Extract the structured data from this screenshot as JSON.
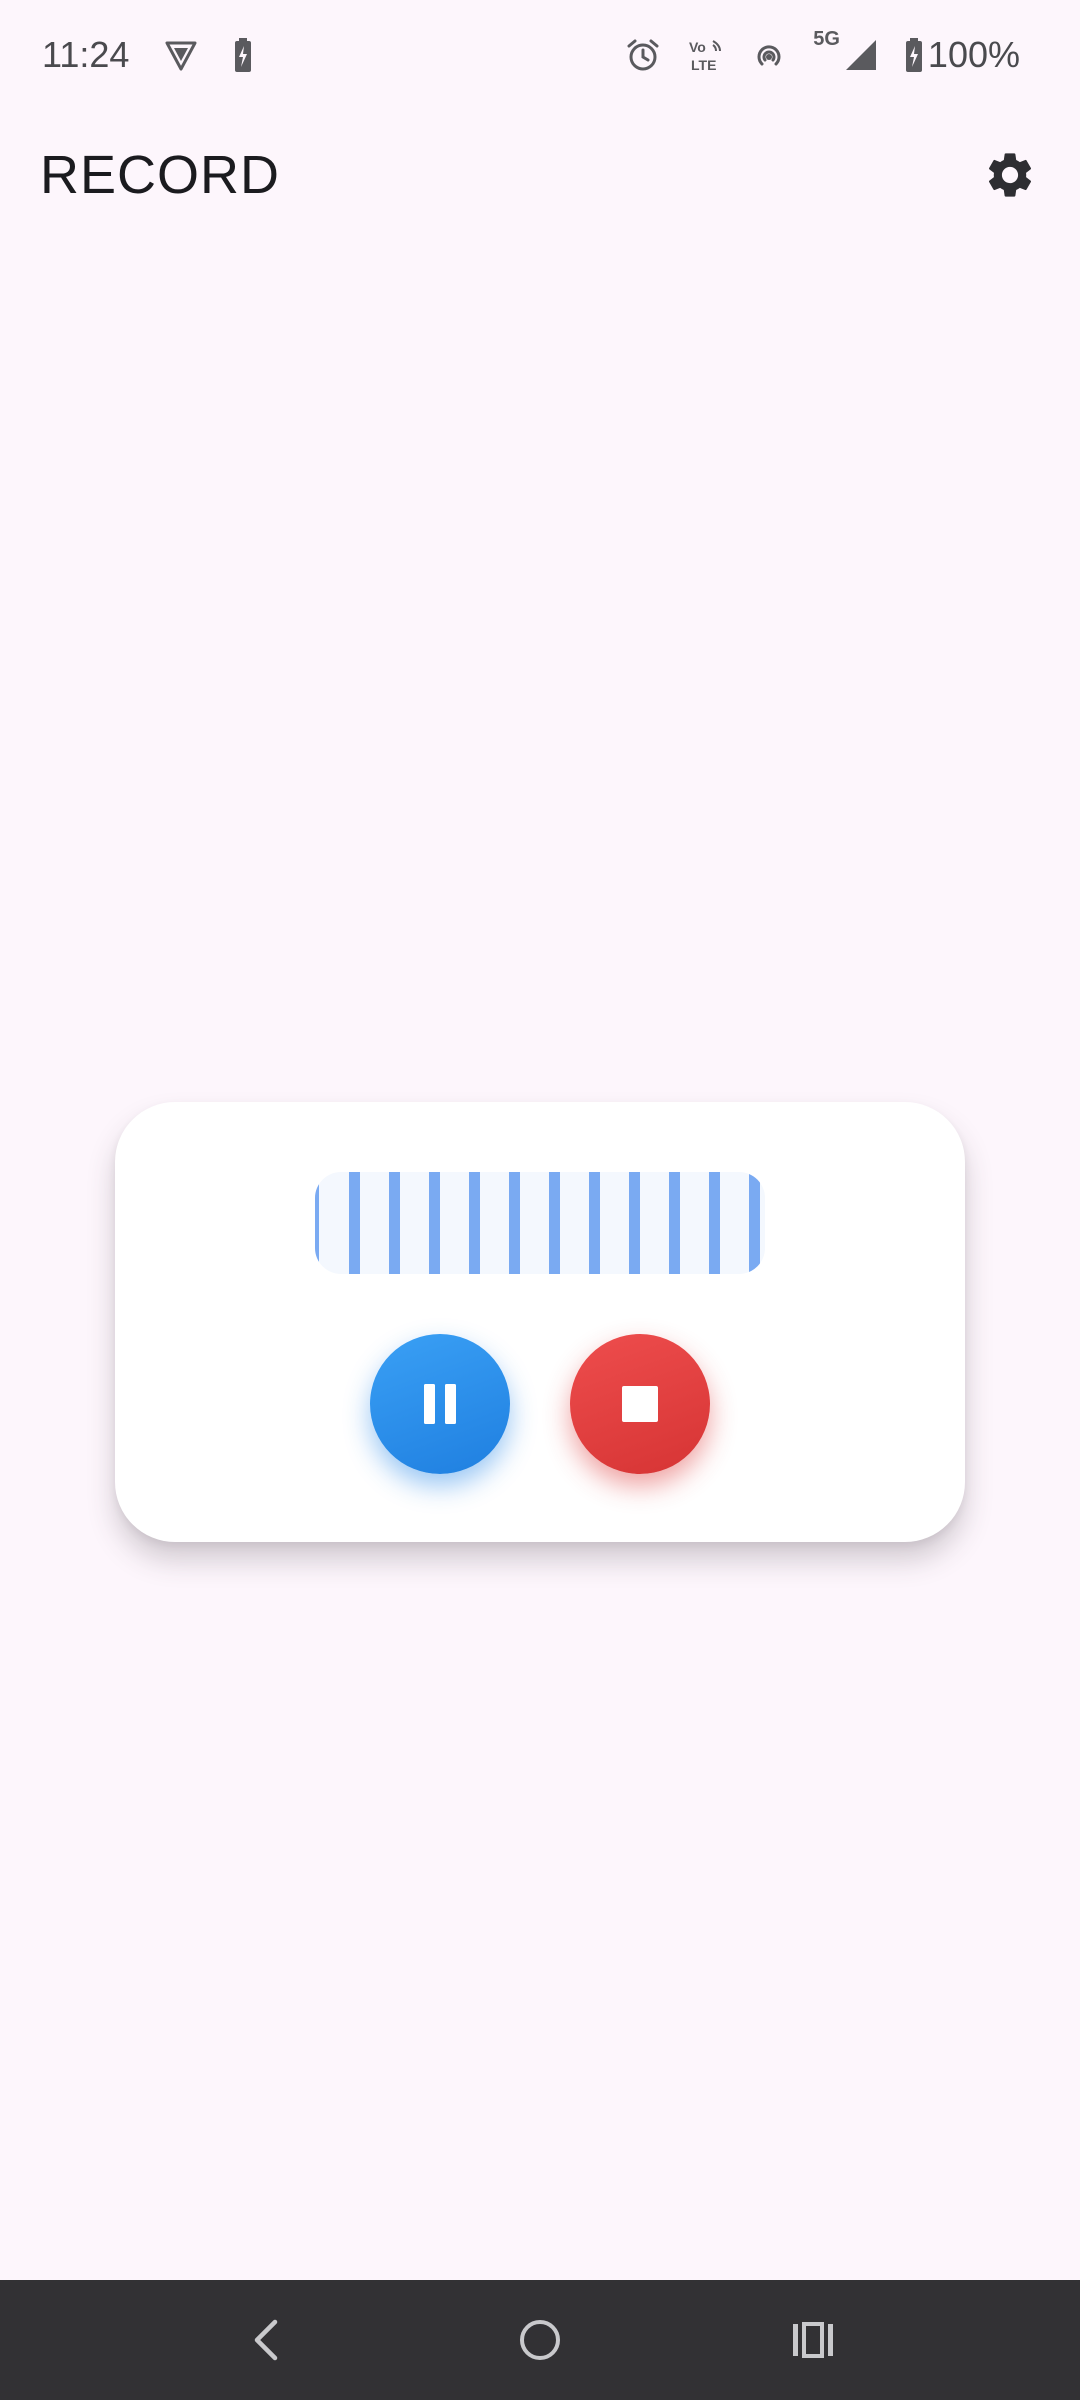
{
  "status_bar": {
    "time": "11:24",
    "battery_percent": "100%",
    "network": "5G",
    "volte": [
      "Vo",
      "LTE"
    ],
    "icons": [
      "vpn-shield-icon",
      "battery-saver-icon",
      "alarm-icon",
      "volte-icon",
      "hotspot-icon",
      "signal-icon",
      "battery-icon"
    ]
  },
  "app_bar": {
    "title": "RECORD",
    "settings_icon": "gear-icon"
  },
  "recorder": {
    "waveform_bar_count": 11,
    "pause_icon": "pause-icon",
    "stop_icon": "stop-icon",
    "colors": {
      "pause": "#2b8fec",
      "stop": "#e04141",
      "wave": "#7aaaf2"
    }
  },
  "nav_bar": {
    "icons": [
      "back-icon",
      "home-icon",
      "recents-icon"
    ]
  },
  "colors": {
    "background": "#fdf6fc",
    "nav_background": "#323134"
  }
}
